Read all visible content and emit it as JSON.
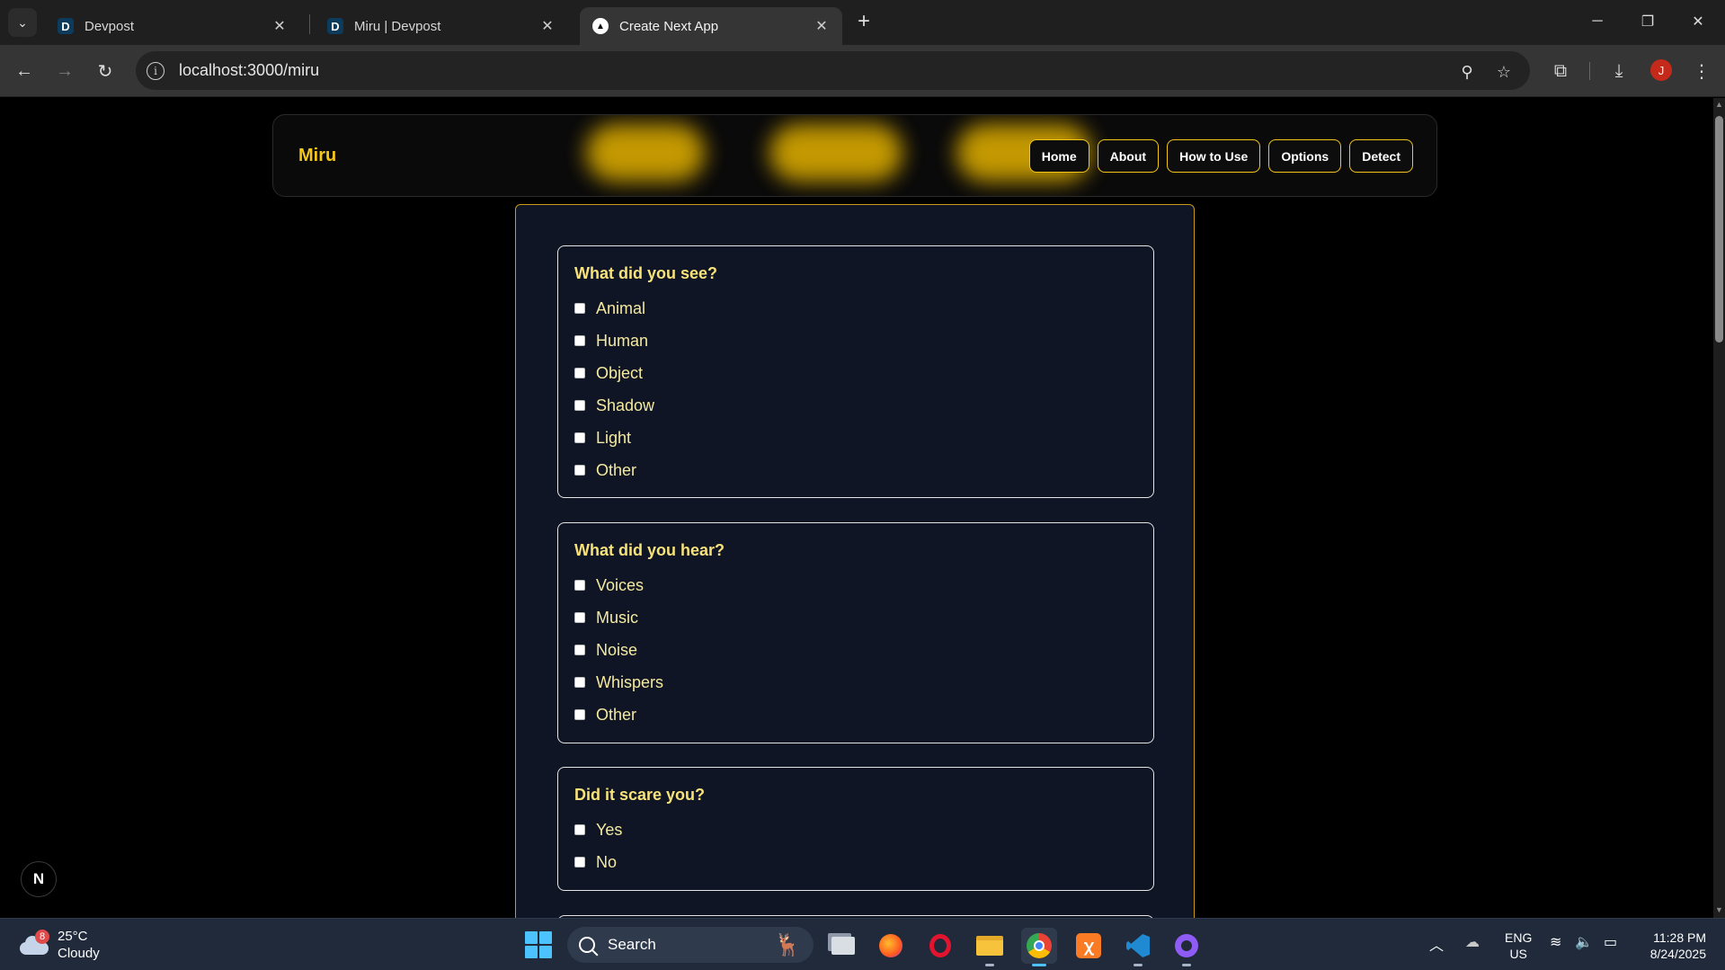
{
  "browser": {
    "tabs": [
      {
        "favicon": "D",
        "title": "Devpost",
        "active": false
      },
      {
        "favicon": "D",
        "title": "Miru | Devpost",
        "active": false
      },
      {
        "favicon": "▲",
        "title": "Create Next App",
        "active": true
      }
    ],
    "url": "localhost:3000/miru",
    "profile_initial": "J"
  },
  "site": {
    "brand": "Miru",
    "nav": [
      "Home",
      "About",
      "How to Use",
      "Options",
      "Detect"
    ]
  },
  "form": {
    "sections": [
      {
        "question": "What did you see?",
        "options": [
          "Animal",
          "Human",
          "Object",
          "Shadow",
          "Light",
          "Other"
        ]
      },
      {
        "question": "What did you hear?",
        "options": [
          "Voices",
          "Music",
          "Noise",
          "Whispers",
          "Other"
        ]
      },
      {
        "question": "Did it scare you?",
        "options": [
          "Yes",
          "No"
        ]
      }
    ]
  },
  "next_badge": "N",
  "taskbar": {
    "weather": {
      "badge": "8",
      "temp": "25°C",
      "condition": "Cloudy"
    },
    "search_label": "Search",
    "lang": {
      "line1": "ENG",
      "line2": "US"
    },
    "clock": {
      "time": "11:28 PM",
      "date": "8/24/2025"
    }
  },
  "colors": {
    "accent": "#f5c518",
    "card_bg": "#0f1524",
    "taskbar": "#202a3a"
  }
}
